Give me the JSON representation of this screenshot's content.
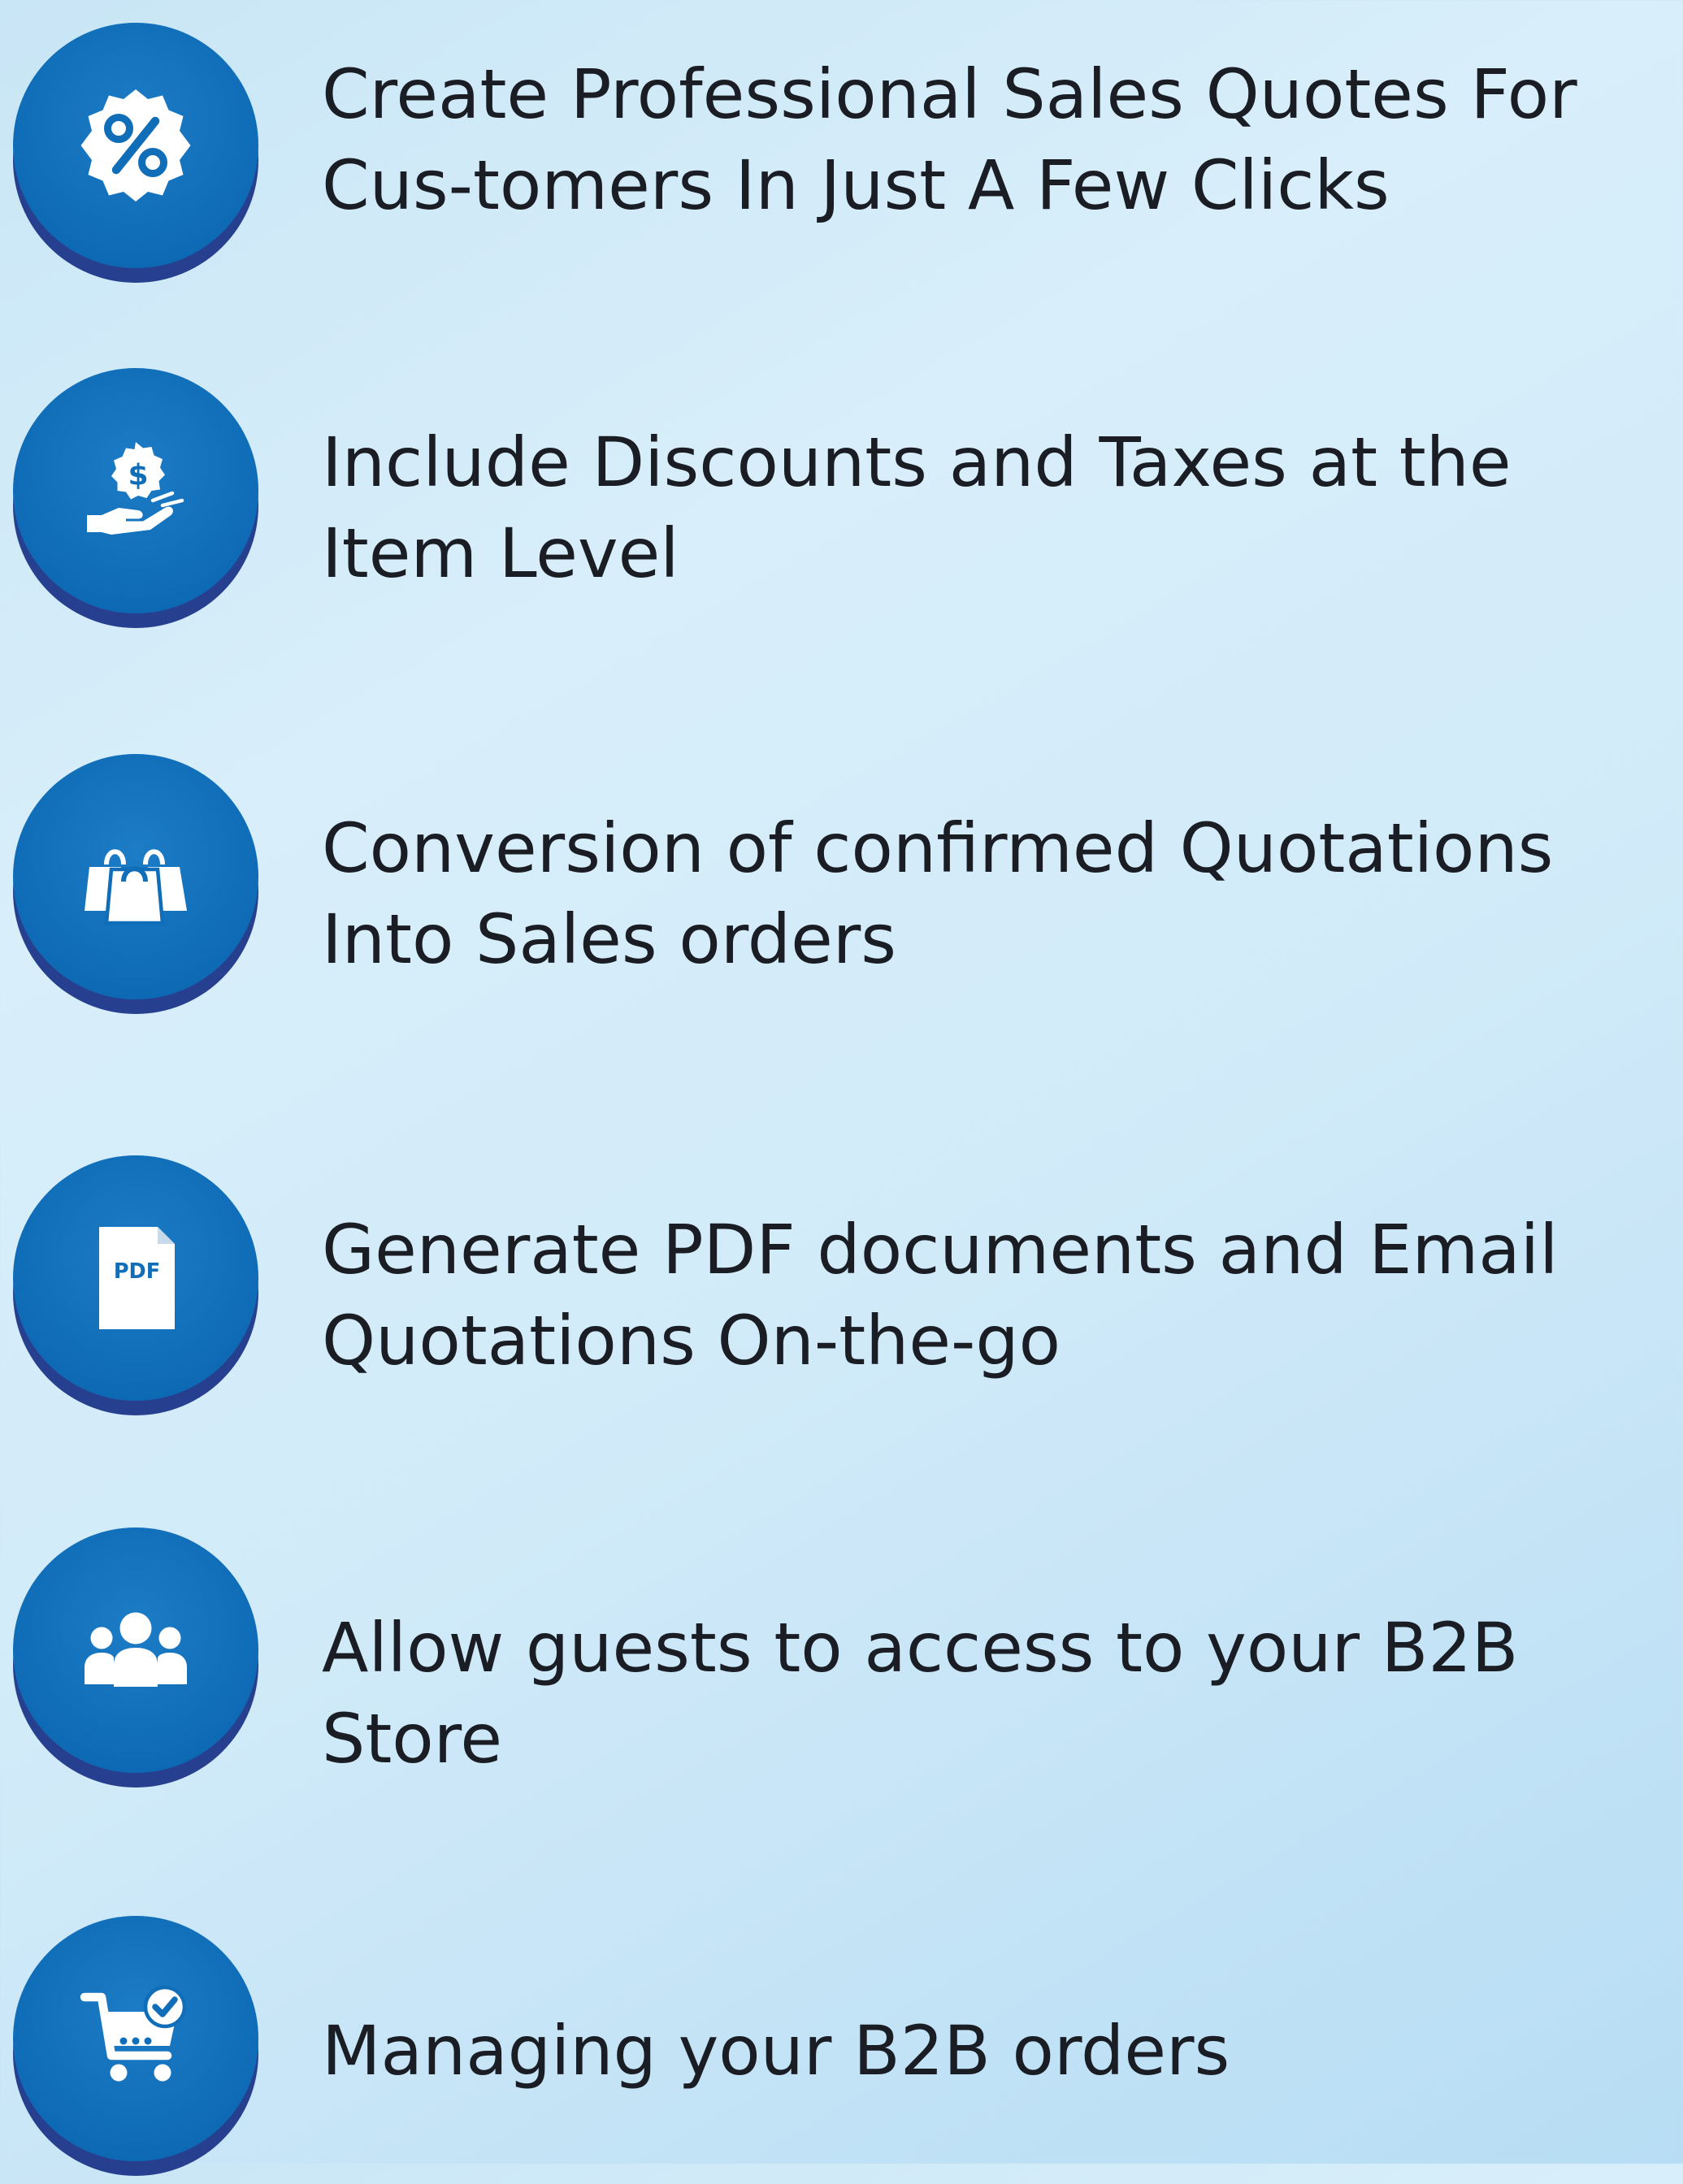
{
  "features": [
    {
      "text": "Create Professional Sales Quotes For Cus-tomers In Just A Few Clicks",
      "icon": "percent-badge-icon"
    },
    {
      "text": "Include Discounts and Taxes at the Item Level",
      "icon": "money-hand-icon"
    },
    {
      "text": "Conversion of confirmed Quotations Into Sales orders",
      "icon": "shopping-bags-icon"
    },
    {
      "text": "Generate PDF documents and Email Quotations On-the-go",
      "icon": "pdf-document-icon",
      "icon_label": "PDF"
    },
    {
      "text": "Allow guests to access to your B2B Store",
      "icon": "users-group-icon"
    },
    {
      "text": "Managing your B2B orders",
      "icon": "cart-check-icon"
    }
  ],
  "colors": {
    "badge": "#106db8",
    "badge_shadow": "#263f8e",
    "text": "#1a1d24",
    "icon": "#ffffff"
  }
}
